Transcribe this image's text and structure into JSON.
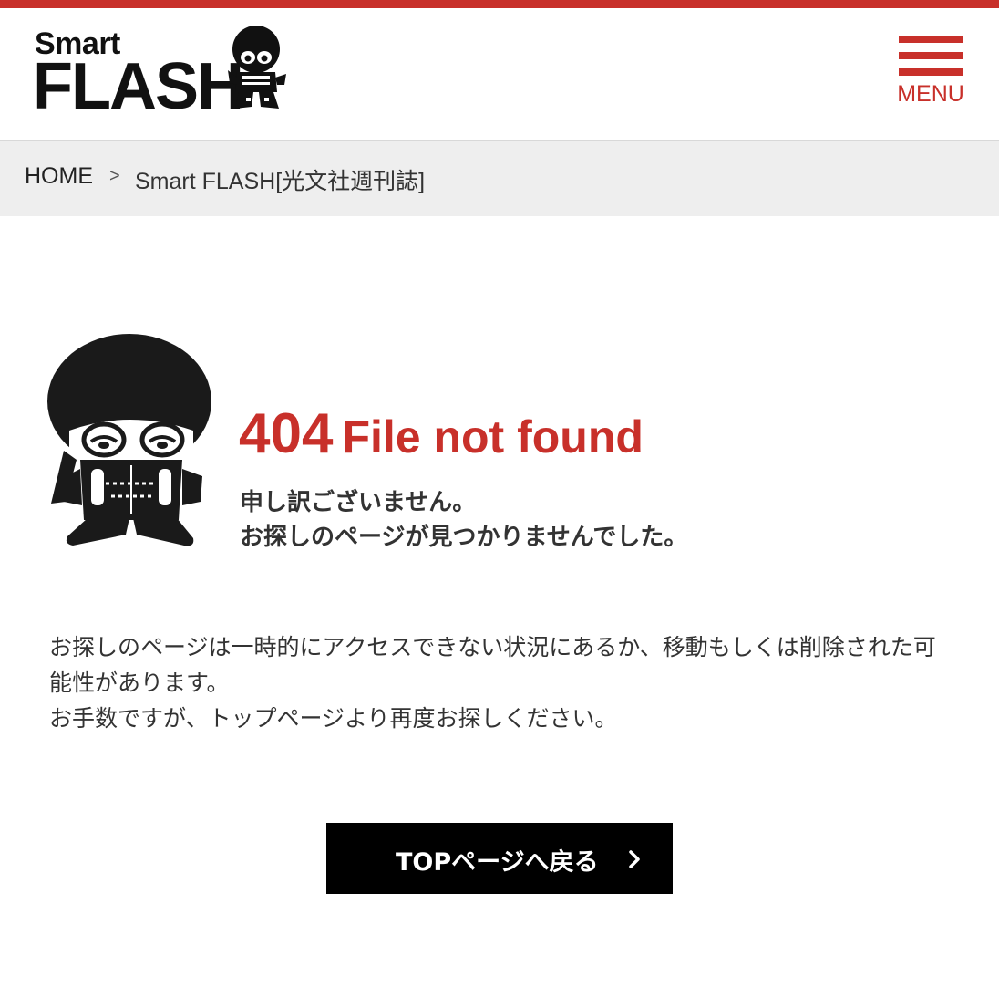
{
  "header": {
    "logo_top": "Smart",
    "logo_main": "FLASH",
    "menu_label": "MENU"
  },
  "breadcrumb": {
    "home": "HOME",
    "separator": ">",
    "current": "Smart FLASH[光文社週刊誌]"
  },
  "error": {
    "code": "404",
    "message": "File not found",
    "apology_line1": "申し訳ございません。",
    "apology_line2": "お探しのページが見つかりませんでした。"
  },
  "description": {
    "line1": "お探しのページは一時的にアクセスできない状況にあるか、移動もしくは削除された可能性があります。",
    "line2": "お手数ですが、トップページより再度お探しください。"
  },
  "top_button": {
    "label": "TOPページへ戻る"
  },
  "colors": {
    "accent": "#c8302a",
    "breadcrumb_bg": "#eeeeee",
    "button_bg": "#000000"
  },
  "icons": {
    "menu": "hamburger-icon",
    "button_arrow": "chevron-right-icon",
    "mascot": "ninja-mascot"
  }
}
